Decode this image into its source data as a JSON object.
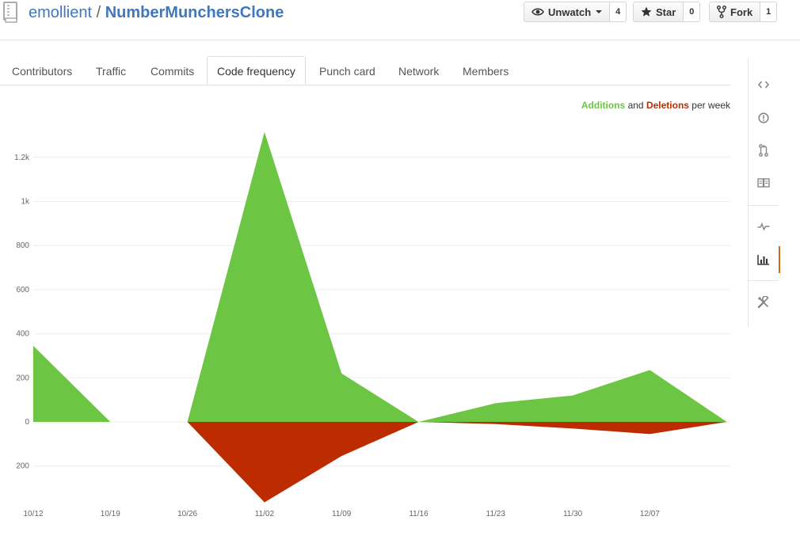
{
  "repo": {
    "owner": "emollient",
    "separator": "/",
    "name": "NumberMunchersClone"
  },
  "actions": {
    "watch": {
      "label": "Unwatch",
      "count": "4"
    },
    "star": {
      "label": "Star",
      "count": "0"
    },
    "fork": {
      "label": "Fork",
      "count": "1"
    }
  },
  "tabs": [
    "Contributors",
    "Traffic",
    "Commits",
    "Code frequency",
    "Punch card",
    "Network",
    "Members"
  ],
  "selected_tab": "Code frequency",
  "legend": {
    "additions": "Additions",
    "and": "and",
    "deletions": "Deletions",
    "suffix": "per week"
  },
  "sidebar_icons": [
    "code-icon",
    "issues-icon",
    "pull-requests-icon",
    "wiki-icon",
    "pulse-icon",
    "graphs-icon",
    "settings-icon"
  ],
  "colors": {
    "additions": "#6cc644",
    "deletions": "#bd2c00",
    "link": "#4078c0",
    "accent": "#d26911"
  },
  "chart_data": {
    "type": "area",
    "x": [
      "10/12",
      "10/19",
      "10/26",
      "11/02",
      "11/09",
      "11/16",
      "11/23",
      "11/30",
      "12/07",
      "12/14"
    ],
    "xticks": [
      "10/12",
      "10/19",
      "10/26",
      "11/02",
      "11/09",
      "11/16",
      "11/23",
      "11/30",
      "12/07"
    ],
    "yticks": [
      "1.2k",
      "1k",
      "800",
      "600",
      "400",
      "200",
      "0",
      "200"
    ],
    "series": [
      {
        "name": "Additions",
        "values": [
          345,
          0,
          0,
          1315,
          220,
          0,
          85,
          120,
          235,
          0
        ],
        "segments": [
          [
            0,
            1
          ],
          [
            2,
            9
          ]
        ]
      },
      {
        "name": "Deletions",
        "values": [
          0,
          0,
          0,
          -365,
          -155,
          0,
          -10,
          -30,
          -55,
          0
        ],
        "segments": [
          [
            0,
            1
          ],
          [
            2,
            9
          ]
        ]
      }
    ],
    "ylim": [
      -365,
      1320
    ],
    "grid": true
  }
}
